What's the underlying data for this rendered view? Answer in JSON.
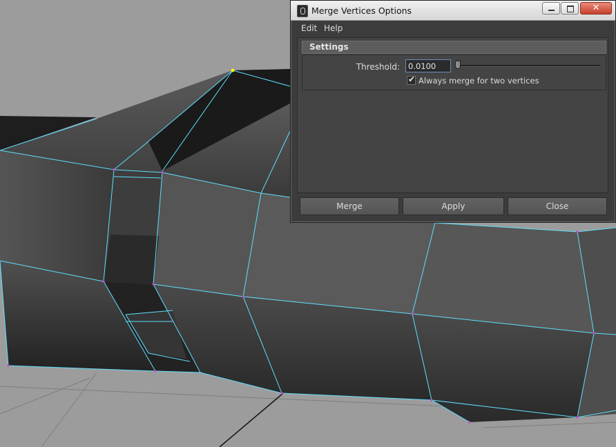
{
  "window": {
    "title": "Merge Vertices Options",
    "icon": "maya-app-icon",
    "controls": {
      "minimize": "minimize-icon",
      "maximize": "maximize-icon",
      "close": "✕"
    }
  },
  "menu": {
    "items": [
      "Edit",
      "Help"
    ]
  },
  "settings": {
    "section_title": "Settings",
    "threshold_label": "Threshold:",
    "threshold_value": "0.0100",
    "slider_fraction": 0.0,
    "checkbox_checked": true,
    "checkbox_glyph": "✔",
    "checkbox_label": "Always merge for two vertices"
  },
  "buttons": {
    "merge": "Merge",
    "apply": "Apply",
    "close": "Close"
  },
  "colors": {
    "wireframe": "#5fe0ff",
    "vertex": "#d040d0",
    "selected_vertex": "#ffff00",
    "viewport_bg": "#9c9c9c"
  }
}
